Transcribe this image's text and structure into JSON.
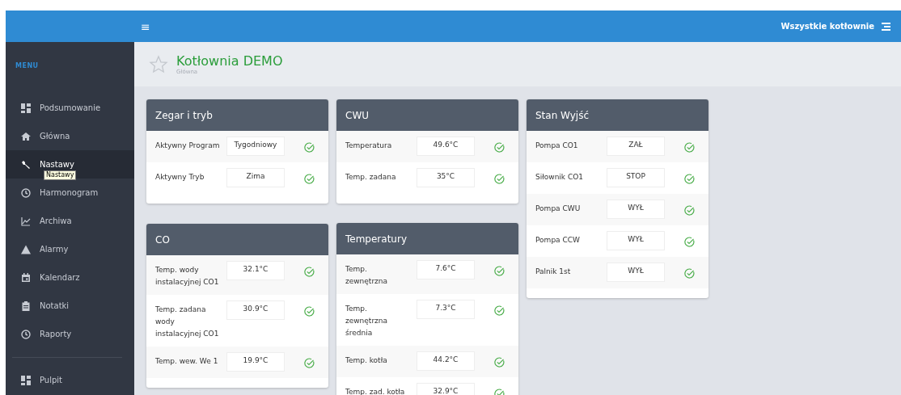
{
  "topbar": {
    "menu_glyph": "≡",
    "right_label": "Wszystkie kotłownie"
  },
  "sidebar": {
    "menu_label": "MENU",
    "groups": [
      [
        {
          "label": "Podsumowanie",
          "selected": false
        },
        {
          "label": "Główna",
          "selected": false
        },
        {
          "label": "Nastawy",
          "selected": true,
          "tooltip": "Nastawy"
        },
        {
          "label": "Harmonogram",
          "selected": false
        },
        {
          "label": "Archiwa",
          "selected": false
        },
        {
          "label": "Alarmy",
          "selected": false
        },
        {
          "label": "Kalendarz",
          "selected": false
        },
        {
          "label": "Notatki",
          "selected": false
        },
        {
          "label": "Raporty",
          "selected": false
        }
      ],
      [
        {
          "label": "Pulpit",
          "selected": false
        }
      ]
    ]
  },
  "page": {
    "title": "Kotłownia DEMO",
    "breadcrumb": "Główna"
  },
  "columns": [
    [
      {
        "title": "Zegar i tryb",
        "rows": [
          {
            "label": "Aktywny Program",
            "value": "Tygodniowy"
          },
          {
            "label": "Aktywny Tryb",
            "value": "Zima"
          }
        ]
      },
      {
        "title": "CO",
        "rows": [
          {
            "label": "Temp. wody instalacyjnej CO1",
            "value": "32.1°C"
          },
          {
            "label": "Temp. zadana wody instalacyjnej CO1",
            "value": "30.9°C"
          },
          {
            "label": "Temp. wew. We 1",
            "value": "19.9°C"
          }
        ]
      }
    ],
    [
      {
        "title": "CWU",
        "rows": [
          {
            "label": "Temperatura",
            "value": "49.6°C"
          },
          {
            "label": "Temp. zadana",
            "value": "35°C"
          }
        ]
      },
      {
        "title": "Temperatury",
        "rows": [
          {
            "label": "Temp. zewnętrzna",
            "value": "7.6°C"
          },
          {
            "label": "Temp. zewnętrzna średnia",
            "value": "7.3°C"
          },
          {
            "label": "Temp. kotła",
            "value": "44.2°C"
          },
          {
            "label": "Temp. zad. kotła",
            "value": "32.9°C"
          }
        ]
      }
    ],
    [
      {
        "title": "Stan Wyjść",
        "rows": [
          {
            "label": "Pompa CO1",
            "value": "ZAŁ"
          },
          {
            "label": "Siłownik CO1",
            "value": "STOP"
          },
          {
            "label": "Pompa CWU",
            "value": "WYŁ"
          },
          {
            "label": "Pompa CCW",
            "value": "WYŁ"
          },
          {
            "label": "Palnik 1st",
            "value": "WYŁ"
          }
        ]
      }
    ]
  ]
}
